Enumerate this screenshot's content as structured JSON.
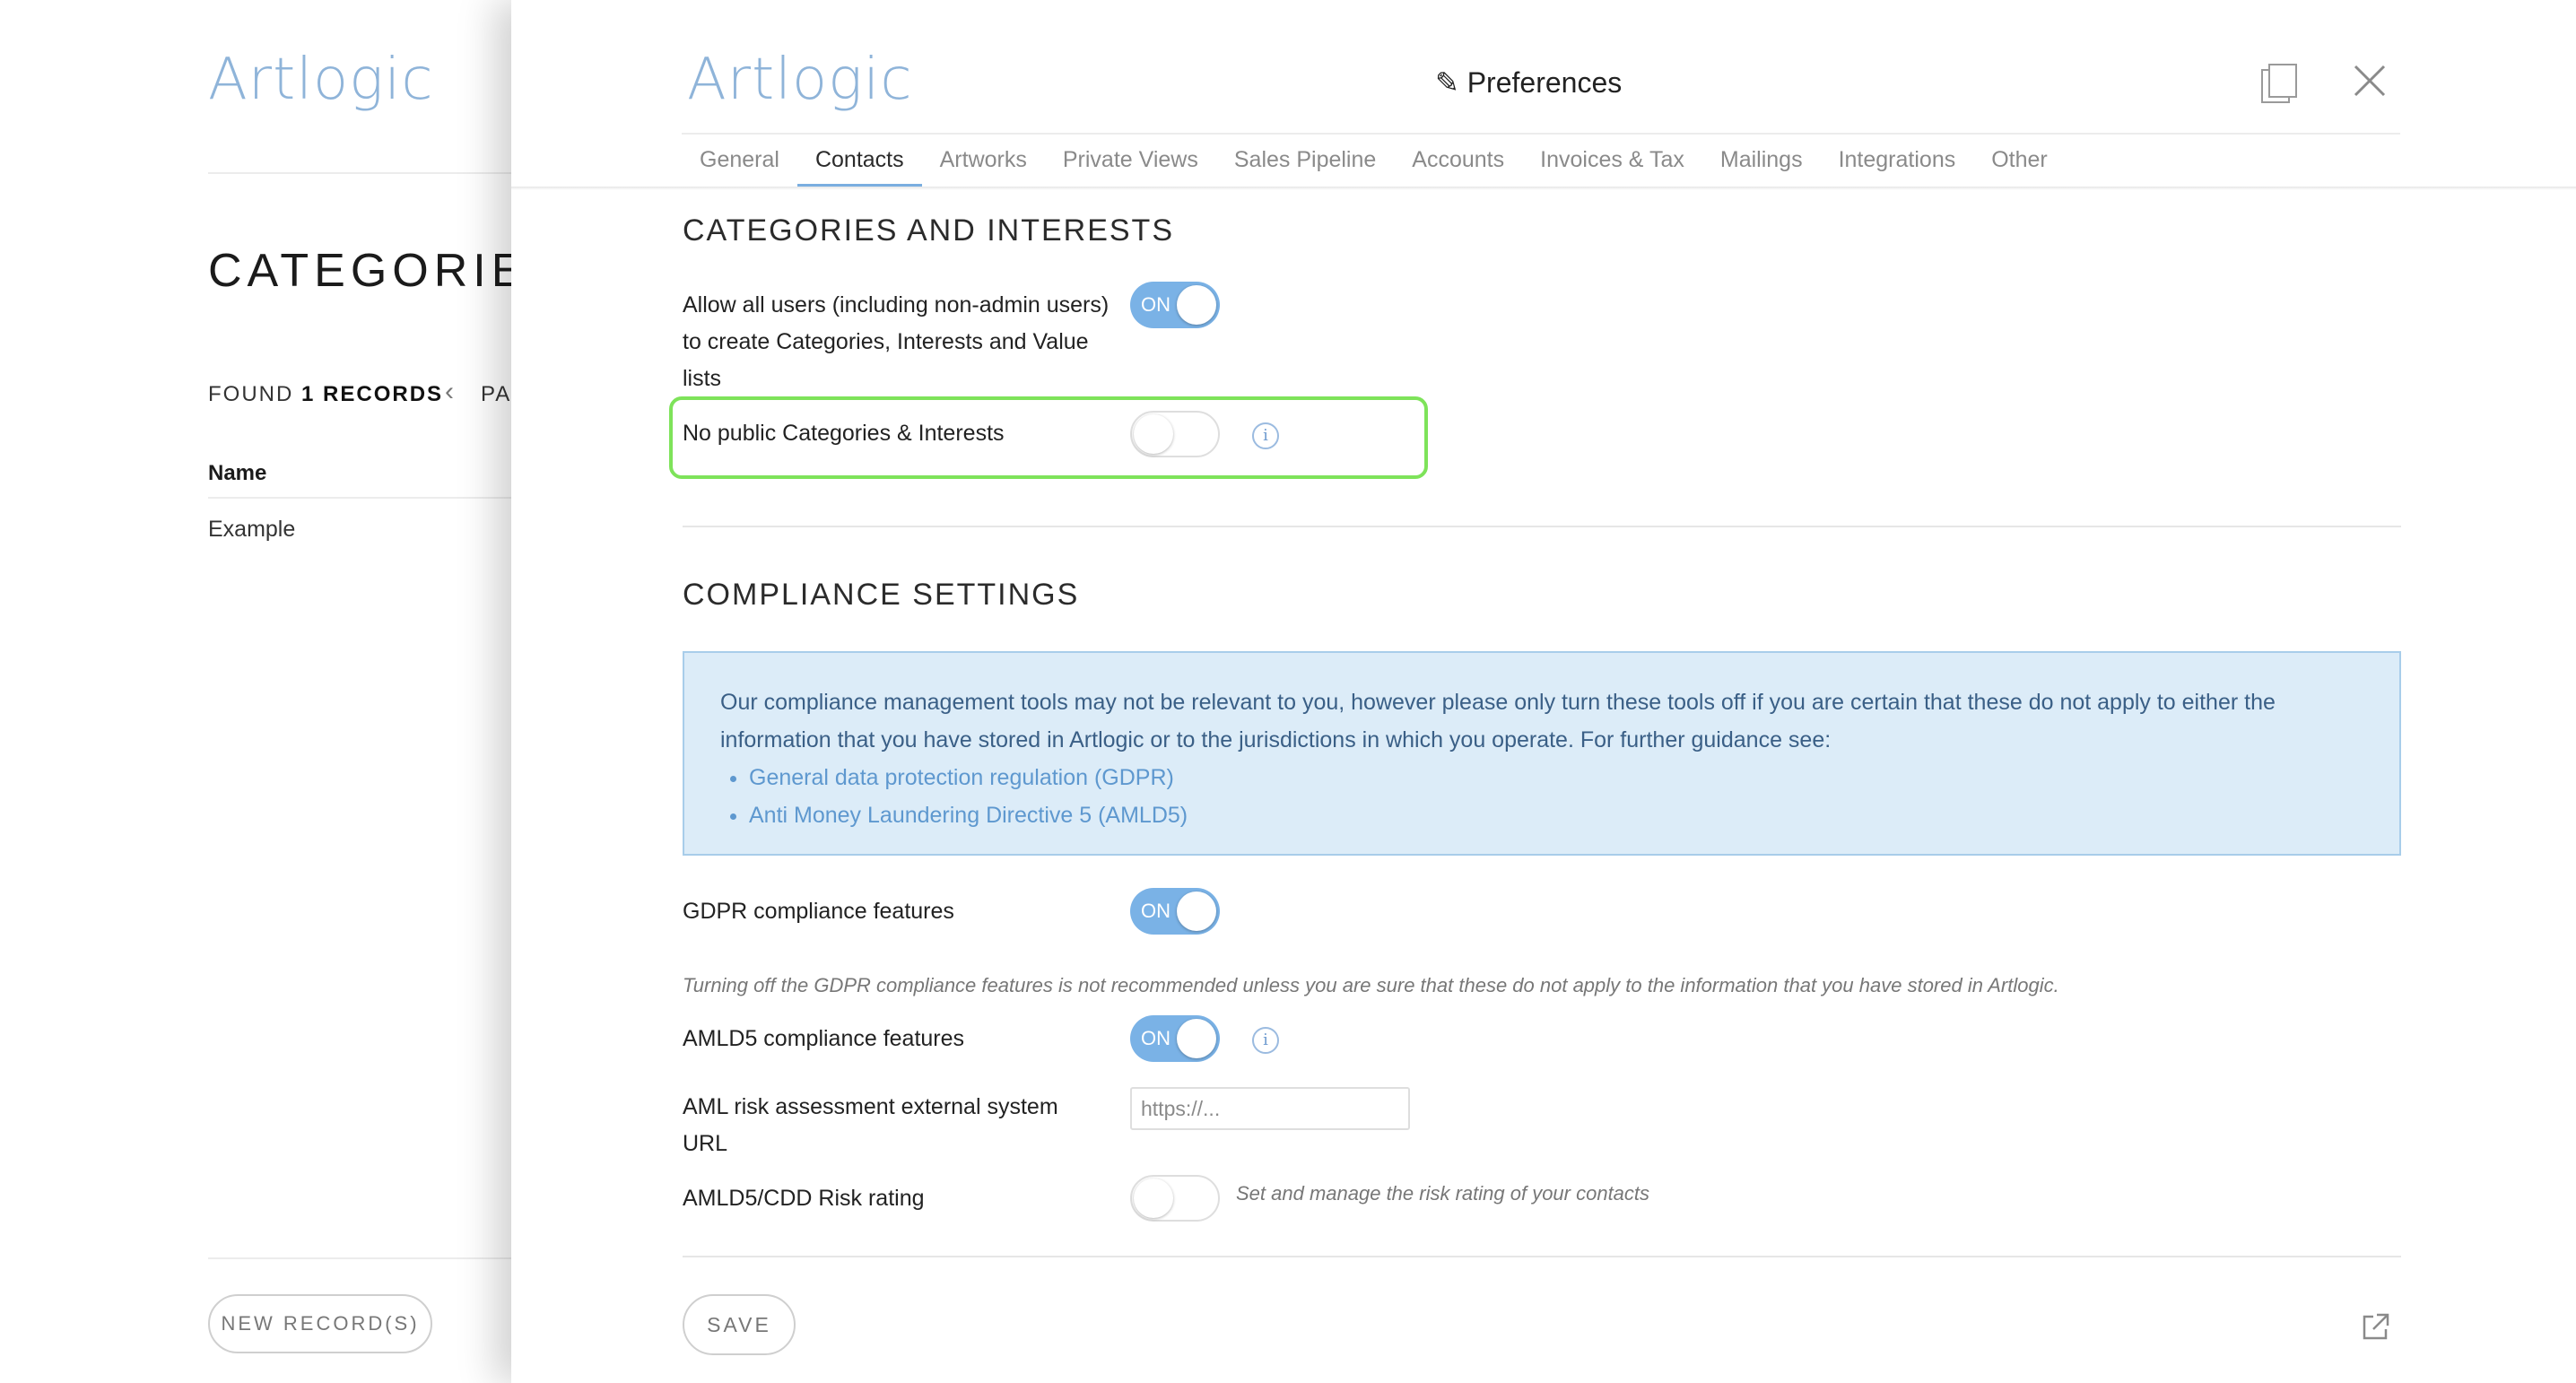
{
  "background": {
    "logo": "Artlogic",
    "title": "CATEGORIES",
    "found_prefix": "FOUND",
    "found_count": "1 RECORDS",
    "pager_text": "PA",
    "column_header": "Name",
    "rows": [
      "Example"
    ],
    "new_button": "NEW RECORD(S)"
  },
  "modal": {
    "logo": "Artlogic",
    "title": "✎ Preferences",
    "tabs": [
      {
        "label": "General"
      },
      {
        "label": "Contacts",
        "active": true
      },
      {
        "label": "Artworks"
      },
      {
        "label": "Private Views"
      },
      {
        "label": "Sales Pipeline"
      },
      {
        "label": "Accounts"
      },
      {
        "label": "Invoices & Tax"
      },
      {
        "label": "Mailings"
      },
      {
        "label": "Integrations"
      },
      {
        "label": "Other"
      }
    ],
    "categories": {
      "heading": "CATEGORIES AND INTERESTS",
      "allow_label": "Allow all users (including non-admin users) to create Categories, Interests and Value lists",
      "allow_toggle": "ON",
      "no_public_label": "No public Categories & Interests"
    },
    "compliance": {
      "heading": "COMPLIANCE SETTINGS",
      "info_text": "Our compliance management tools may not be relevant to you, however please only turn these tools off if you are certain that these do not apply to either the information that you have stored in Artlogic or to the jurisdictions in which you operate. For further guidance see:",
      "links": [
        "General data protection regulation (GDPR)",
        "Anti Money Laundering Directive 5 (AMLD5)"
      ],
      "gdpr_label": "GDPR compliance features",
      "gdpr_toggle": "ON",
      "gdpr_note": "Turning off the GDPR compliance features is not recommended unless you are sure that these do not apply to the information that you have stored in Artlogic.",
      "amld5_label": "AMLD5 compliance features",
      "amld5_toggle": "ON",
      "aml_url_label": "AML risk assessment external system URL",
      "aml_url_placeholder": "https://...",
      "risk_label": "AMLD5/CDD Risk rating",
      "risk_note": "Set and manage the risk rating of your contacts"
    },
    "save_button": "SAVE",
    "info_glyph": "i"
  },
  "colors": {
    "accent": "#7ab2e6",
    "highlight": "#7ee35a",
    "info_bg": "#dcecf8"
  }
}
